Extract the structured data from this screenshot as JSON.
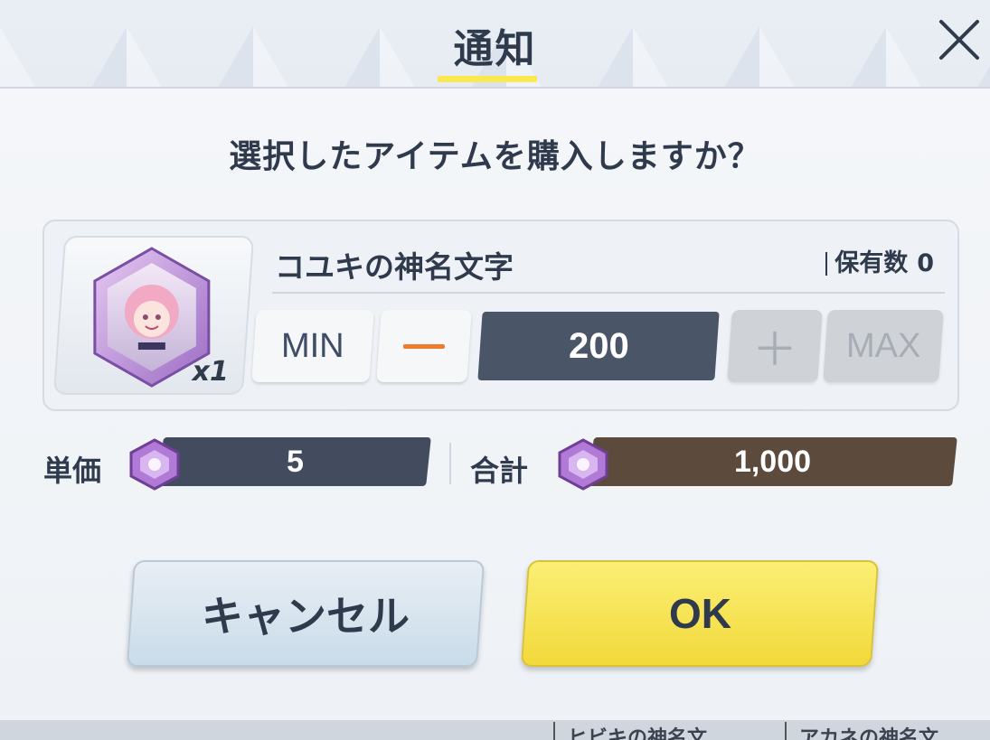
{
  "dialog": {
    "title": "通知",
    "question": "選択したアイテムを購入しますか？"
  },
  "item": {
    "name": "コユキの神名文字",
    "owned_label": "保有数",
    "owned_value": "0",
    "thumb_quantity": "x1",
    "thumb_icon": "character-hexagon-token-icon"
  },
  "quantity": {
    "min_label": "MIN",
    "max_label": "MAX",
    "minus_symbol": "−",
    "plus_symbol": "＋",
    "value": "200"
  },
  "price": {
    "unit_label": "単価",
    "unit_value": "5",
    "total_label": "合計",
    "total_value": "1,000",
    "currency_icon": "purple-gem-icon"
  },
  "buttons": {
    "cancel_label": "キャンセル",
    "ok_label": "OK"
  },
  "background": {
    "tags": [
      "ヒビキの神名文",
      "アカネの神名文"
    ]
  },
  "colors": {
    "title_underline": "#fbe84e",
    "qty_display": "#4a5568",
    "unit_bar": "#434c5e",
    "total_bar": "#5c4a3c",
    "ok_button": "#f5e04a",
    "minus_accent": "#f07a2b"
  }
}
